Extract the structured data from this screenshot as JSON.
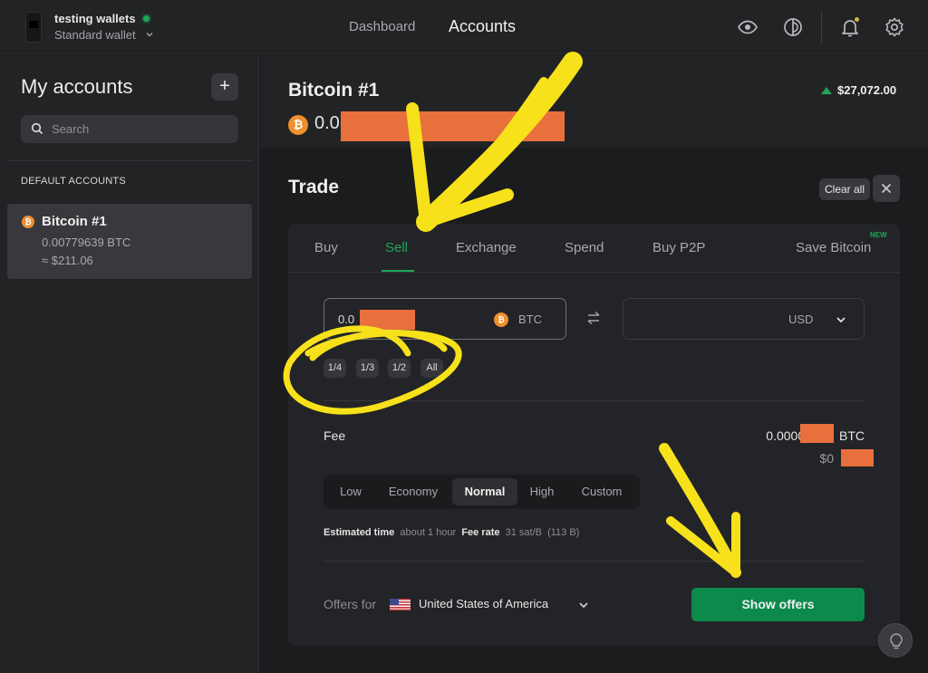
{
  "topbar": {
    "wallet_name": "testing wallets",
    "wallet_type": "Standard wallet",
    "nav": [
      {
        "label": "Dashboard",
        "active": false
      },
      {
        "label": "Accounts",
        "active": true
      }
    ],
    "icons": [
      "eye-icon",
      "theme-contrast-icon",
      "bell-icon",
      "gear-icon"
    ],
    "notification_dot_color": "#d6b24a"
  },
  "sidebar": {
    "title": "My accounts",
    "add_label": "+",
    "search_placeholder": "Search",
    "section_label": "DEFAULT ACCOUNTS",
    "accounts": [
      {
        "name": "Bitcoin #1",
        "balance": "0.00779639 BTC",
        "fiat": "≈ $211.06",
        "selected": true
      }
    ]
  },
  "header": {
    "account_title": "Bitcoin #1",
    "balance_visible": "0.0",
    "price": "$27,072.00",
    "price_trend": "up"
  },
  "trade": {
    "title": "Trade",
    "clear_all_label": "Clear all",
    "tabs": [
      {
        "label": "Buy",
        "active": false
      },
      {
        "label": "Sell",
        "active": true
      },
      {
        "label": "Exchange",
        "active": false
      },
      {
        "label": "Spend",
        "active": false
      },
      {
        "label": "Buy P2P",
        "active": false
      },
      {
        "label": "Save Bitcoin",
        "active": false,
        "badge": "NEW"
      }
    ],
    "from": {
      "value_visible": "0.0",
      "currency": "BTC"
    },
    "to": {
      "value": "",
      "currency": "USD"
    },
    "fractions": [
      "1/4",
      "1/3",
      "1/2",
      "All"
    ],
    "fee": {
      "label": "Fee",
      "btc_visible": "0.0000",
      "btc_unit": "BTC",
      "usd_visible": "$0",
      "levels": [
        {
          "label": "Low",
          "active": false
        },
        {
          "label": "Economy",
          "active": false
        },
        {
          "label": "Normal",
          "active": true
        },
        {
          "label": "High",
          "active": false
        },
        {
          "label": "Custom",
          "active": false
        }
      ],
      "estimated_time_label": "Estimated time",
      "estimated_time_value": "about 1 hour",
      "fee_rate_label": "Fee rate",
      "fee_rate_value": "31 sat/B",
      "size": "(113 B)"
    },
    "offers_for_label": "Offers for",
    "country": "United States of America",
    "show_offers_label": "Show offers"
  },
  "colors": {
    "accent_green": "#1fa55a",
    "button_green": "#0c8a4c",
    "bitcoin_orange": "#ef8f2d",
    "redaction": "#e8703d",
    "annotation_yellow": "#f7e11b"
  }
}
